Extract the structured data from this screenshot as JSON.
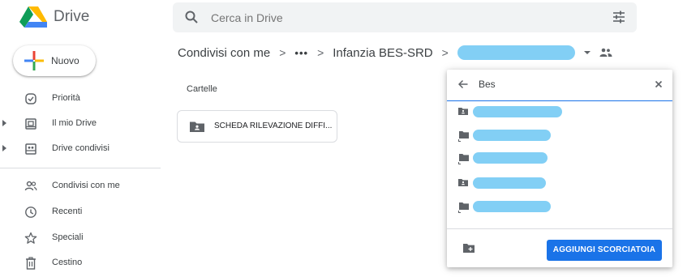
{
  "header": {
    "app_name": "Drive",
    "search_placeholder": "Cerca in Drive"
  },
  "sidebar": {
    "new_label": "Nuovo",
    "items": [
      {
        "label": "Priorità",
        "icon": "check-circle-icon",
        "expandable": false
      },
      {
        "label": "Il mio Drive",
        "icon": "my-drive-icon",
        "expandable": true
      },
      {
        "label": "Drive condivisi",
        "icon": "shared-drives-icon",
        "expandable": true
      },
      {
        "label": "Condivisi con me",
        "icon": "people-icon",
        "expandable": false
      },
      {
        "label": "Recenti",
        "icon": "clock-icon",
        "expandable": false
      },
      {
        "label": "Speciali",
        "icon": "star-icon",
        "expandable": false
      },
      {
        "label": "Cestino",
        "icon": "trash-icon",
        "expandable": false
      }
    ]
  },
  "breadcrumb": {
    "items": [
      "Condivisi con me",
      "•••",
      "Infanzia BES-SRD"
    ],
    "separator": ">"
  },
  "main": {
    "section_title": "Cartelle",
    "folders": [
      {
        "name": "SCHEDA RILEVAZIONE DIFFI..."
      }
    ]
  },
  "popup": {
    "title": "Bes",
    "rows": [
      {
        "icon": "shared-folder-icon"
      },
      {
        "icon": "folder-shortcut-icon"
      },
      {
        "icon": "folder-shortcut-icon"
      },
      {
        "icon": "shared-folder-icon"
      },
      {
        "icon": "folder-shortcut-icon"
      }
    ],
    "add_button_label": "AGGIUNGI SCORCIATOIA"
  },
  "colors": {
    "accent": "#1a73e8",
    "redaction": "#82cff5",
    "icon_gray": "#5f6368"
  }
}
